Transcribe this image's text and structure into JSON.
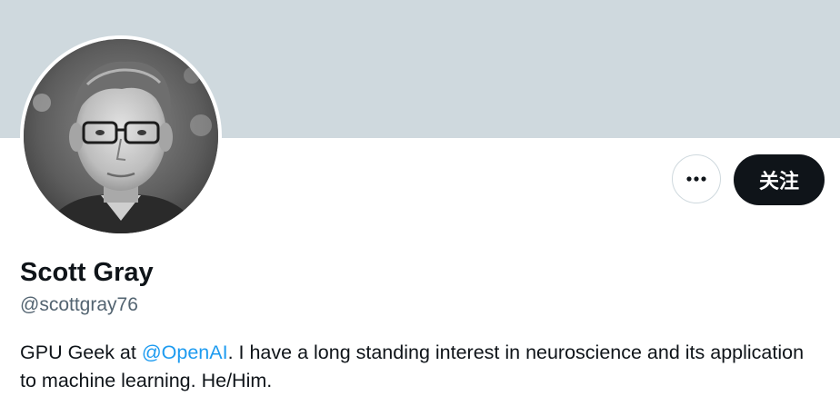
{
  "profile": {
    "display_name": "Scott Gray",
    "handle": "@scottgray76",
    "bio": {
      "prefix": "GPU Geek at ",
      "mention": "@OpenAI",
      "suffix": ". I have a long standing interest in neuroscience and its application to machine learning. He/Him."
    }
  },
  "actions": {
    "more_icon": "more-horizontal-icon",
    "follow_label": "关注"
  },
  "colors": {
    "banner": "#cfd9de",
    "text_primary": "#0f1419",
    "text_secondary": "#536471",
    "link": "#1d9bf0",
    "follow_bg": "#0f1419"
  }
}
